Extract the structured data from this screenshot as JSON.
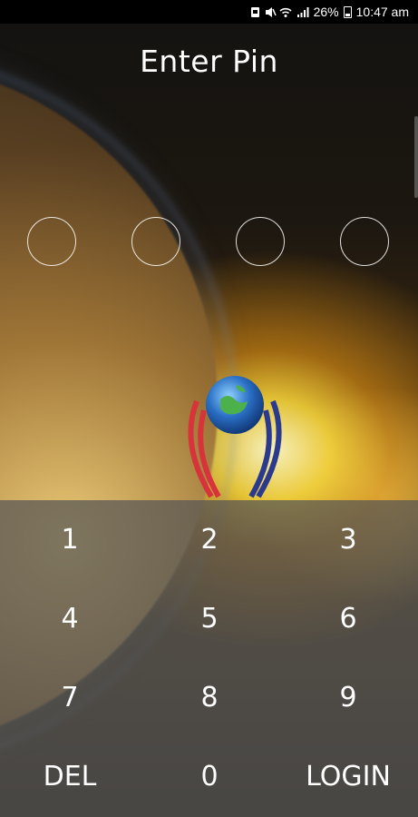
{
  "status_bar": {
    "battery": "26%",
    "time": "10:47 am"
  },
  "title": "Enter Pin",
  "pin": {
    "digits_total": 4,
    "digits_entered": 0
  },
  "keypad": {
    "rows": [
      [
        "1",
        "2",
        "3"
      ],
      [
        "4",
        "5",
        "6"
      ],
      [
        "7",
        "8",
        "9"
      ],
      [
        "DEL",
        "0",
        "LOGIN"
      ]
    ]
  },
  "colors": {
    "keypad_overlay": "#555555",
    "text": "#ffffff"
  }
}
